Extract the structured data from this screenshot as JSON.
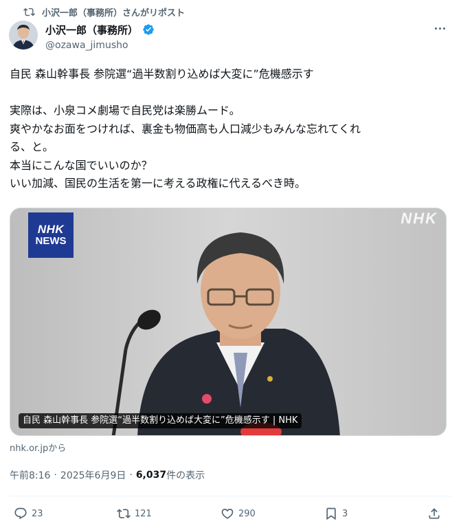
{
  "repost": {
    "label": "小沢一郎（事務所）さんがリポスト"
  },
  "author": {
    "name": "小沢一郎（事務所）",
    "handle": "@ozawa_jimusho",
    "verified": true
  },
  "tweet": {
    "lines": [
      "自民 森山幹事長 参院選“過半数割り込めば大変に”危機感示す",
      "",
      "実際は、小泉コメ劇場で自民党は楽勝ムード。",
      "爽やかなお面をつければ、裏金も物価高も人口減少もみんな忘れてくれ",
      "る、と。",
      "本当にこんな国でいいのか？",
      "いい加減、国民の生活を第一に考える政権に代えるべき時。"
    ]
  },
  "card": {
    "logo_line1": "NHK",
    "logo_line2": "NEWS",
    "watermark": "NHK",
    "caption": "自民 森山幹事長 参院選“過半数割り込めば大変に”危機感示す | NHK",
    "source": "nhk.or.jpから"
  },
  "meta": {
    "time": "午前8:16",
    "date": "2025年6月9日",
    "views": "6,037",
    "views_suffix": " 件の表示"
  },
  "actions": {
    "replies": "23",
    "reposts": "121",
    "likes": "290",
    "bookmarks": "3"
  },
  "colors": {
    "accent": "#1d9bf0",
    "muted": "#536471",
    "text": "#0f1419",
    "nhk_blue": "#1f3a93"
  }
}
